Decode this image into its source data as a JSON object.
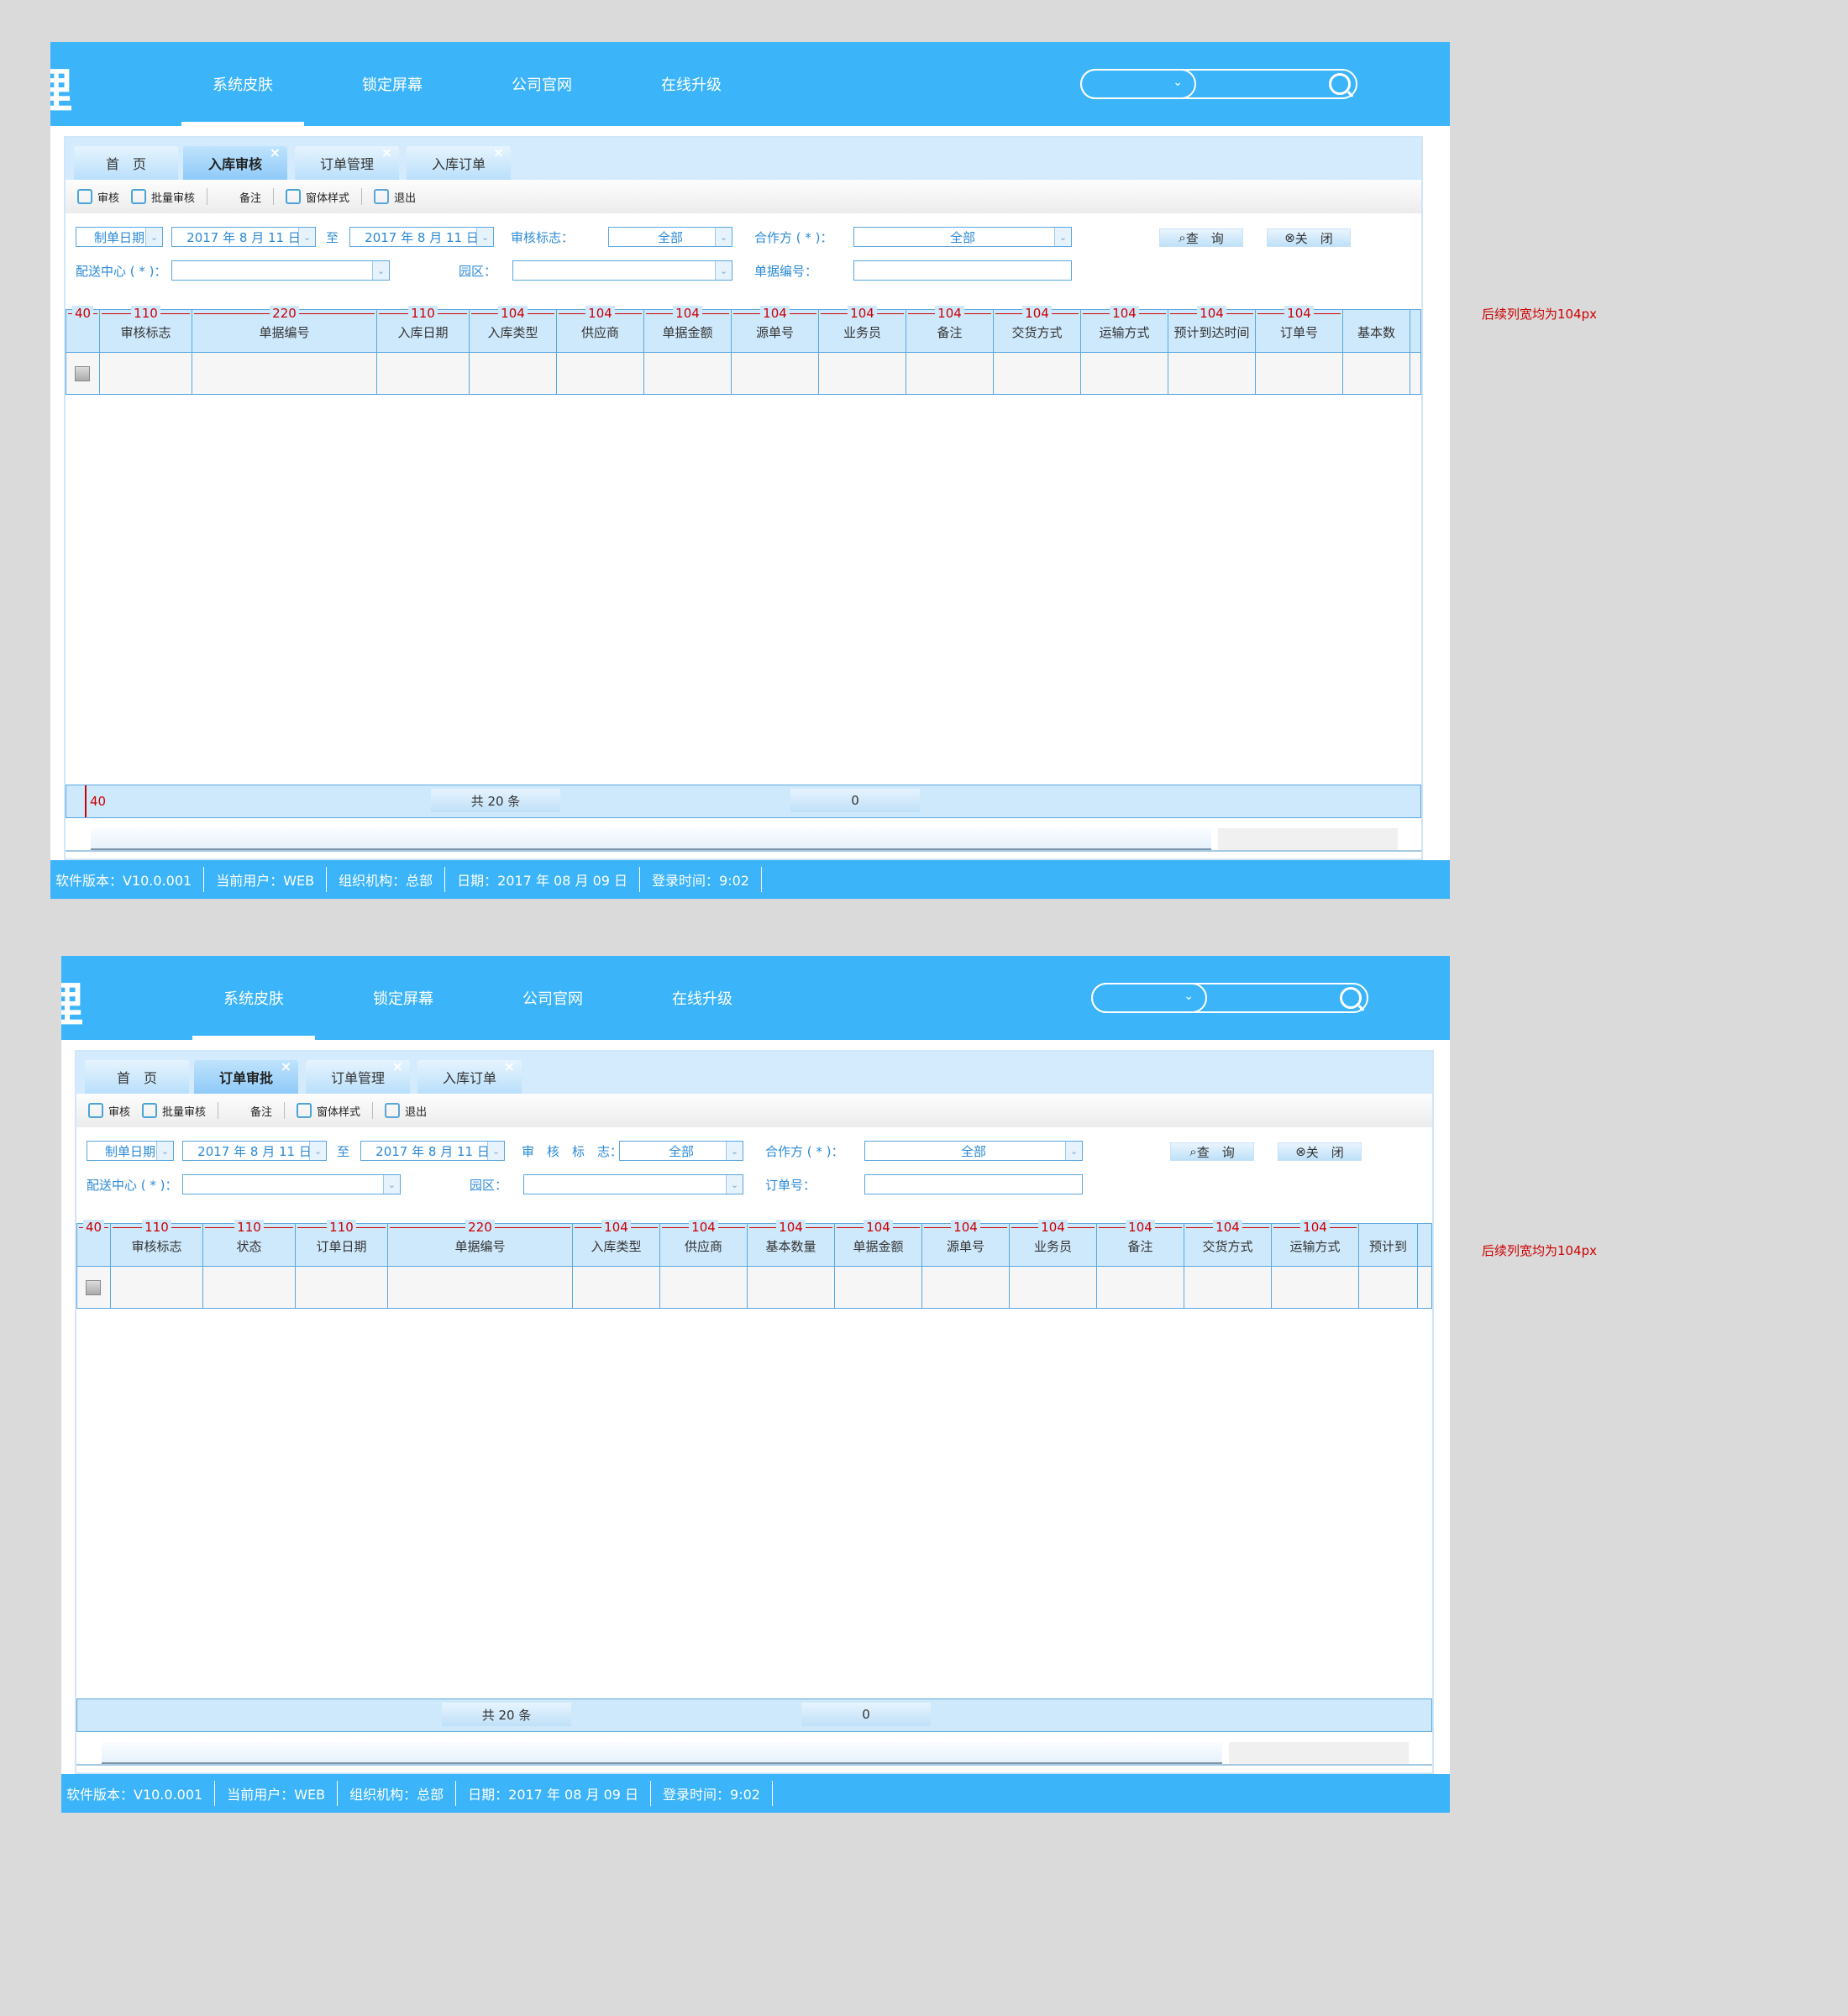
{
  "panels": [
    {
      "logo": "理",
      "nav": [
        "系统皮肤",
        "锁定屏幕",
        "公司官网",
        "在线升级"
      ],
      "tabs": [
        {
          "label": "首　页",
          "closable": false
        },
        {
          "label": "入库审核",
          "closable": true
        },
        {
          "label": "订单管理",
          "closable": true
        },
        {
          "label": "入库订单",
          "closable": true
        }
      ],
      "toolbar": [
        "审核",
        "批量审核",
        "备注",
        "窗体样式",
        "退出"
      ],
      "filter": {
        "date_type": "制单日期",
        "date_from": "2017 年 8 月 11 日",
        "to_label": "至",
        "date_to": "2017 年 8 月 11 日",
        "flag_label": "审核标志：",
        "flag_value": "全部",
        "partner_label": "合作方 ( * )：",
        "partner_value": "全部",
        "query_label": "查　询",
        "close_label": "关　闭",
        "center_label": "配送中心 ( * )：",
        "park_label": "园区：",
        "no_label": "单据编号："
      },
      "columns": [
        {
          "w": "40",
          "label": ""
        },
        {
          "w": "110",
          "label": "审核标志"
        },
        {
          "w": "220",
          "label": "单据编号"
        },
        {
          "w": "110",
          "label": "入库日期"
        },
        {
          "w": "104",
          "label": "入库类型"
        },
        {
          "w": "104",
          "label": "供应商"
        },
        {
          "w": "104",
          "label": "单据金额"
        },
        {
          "w": "104",
          "label": "源单号"
        },
        {
          "w": "104",
          "label": "业务员"
        },
        {
          "w": "104",
          "label": "备注"
        },
        {
          "w": "104",
          "label": "交货方式"
        },
        {
          "w": "104",
          "label": "运输方式"
        },
        {
          "w": "104",
          "label": "预计到达时间"
        },
        {
          "w": "104",
          "label": "订单号"
        },
        {
          "w": "",
          "label": "基本数"
        }
      ],
      "footer": {
        "red": "40",
        "total": "共 20 条",
        "sum": "0"
      },
      "status": [
        "软件版本：V10.0.001",
        "当前用户：WEB",
        "组织机构：总部",
        "日期：2017 年 08 月 09 日",
        "登录时间：9:02"
      ],
      "note": "后续列宽均为104px"
    },
    {
      "logo": "理",
      "nav": [
        "系统皮肤",
        "锁定屏幕",
        "公司官网",
        "在线升级"
      ],
      "tabs": [
        {
          "label": "首　页",
          "closable": false
        },
        {
          "label": "订单审批",
          "closable": true
        },
        {
          "label": "订单管理",
          "closable": true
        },
        {
          "label": "入库订单",
          "closable": true
        }
      ],
      "toolbar": [
        "审核",
        "批量审核",
        "备注",
        "窗体样式",
        "退出"
      ],
      "filter": {
        "date_type": "制单日期",
        "date_from": "2017 年 8 月 11 日",
        "to_label": "至",
        "date_to": "2017 年 8 月 11 日",
        "flag_label": "审　核　标　志：",
        "flag_value": "全部",
        "partner_label": "合作方 ( * )：",
        "partner_value": "全部",
        "query_label": "查　询",
        "close_label": "关　闭",
        "center_label": "配送中心 ( * )：",
        "park_label": "园区：",
        "no_label": "订单号："
      },
      "columns": [
        {
          "w": "40",
          "label": ""
        },
        {
          "w": "110",
          "label": "审核标志"
        },
        {
          "w": "110",
          "label": "状态"
        },
        {
          "w": "110",
          "label": "订单日期"
        },
        {
          "w": "220",
          "label": "单据编号"
        },
        {
          "w": "104",
          "label": "入库类型"
        },
        {
          "w": "104",
          "label": "供应商"
        },
        {
          "w": "104",
          "label": "基本数量"
        },
        {
          "w": "104",
          "label": "单据金额"
        },
        {
          "w": "104",
          "label": "源单号"
        },
        {
          "w": "104",
          "label": "业务员"
        },
        {
          "w": "104",
          "label": "备注"
        },
        {
          "w": "104",
          "label": "交货方式"
        },
        {
          "w": "104",
          "label": "运输方式"
        },
        {
          "w": "",
          "label": "预计到"
        }
      ],
      "footer": {
        "red": "",
        "total": "共 20 条",
        "sum": "0"
      },
      "status": [
        "软件版本：V10.0.001",
        "当前用户：WEB",
        "组织机构：总部",
        "日期：2017 年 08 月 09 日",
        "登录时间：9:02"
      ],
      "note": "后续列宽均为104px"
    }
  ]
}
